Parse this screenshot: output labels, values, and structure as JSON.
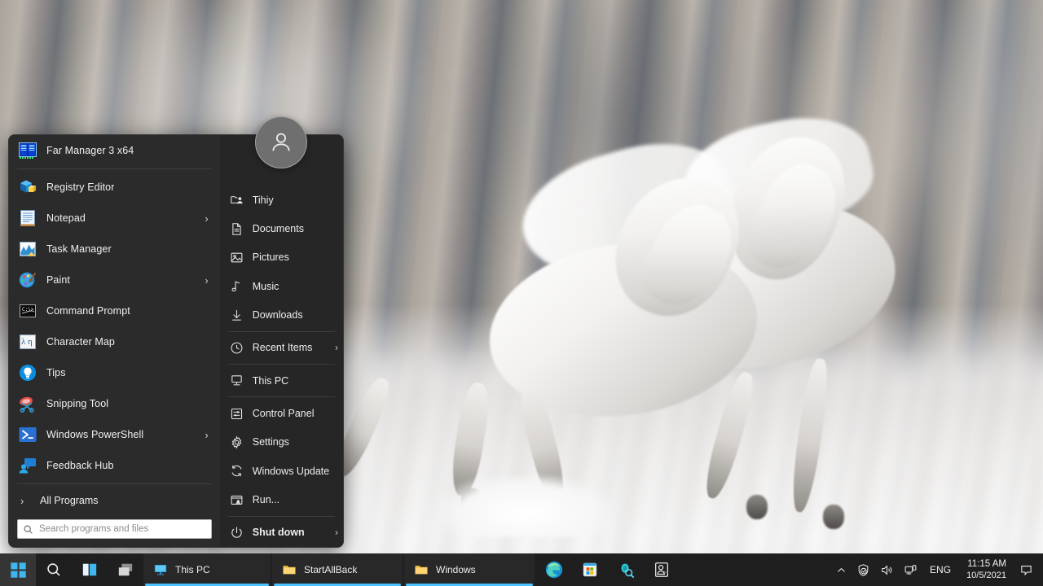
{
  "desktop": {
    "wallpaper_description": "Two white horses galloping in snow (blurred background)"
  },
  "start_menu": {
    "avatar_name": "user-avatar",
    "left_items": [
      {
        "label": "Far Manager 3 x64",
        "icon": "far-manager-icon",
        "submenu": false,
        "pinned": true
      },
      {
        "label": "Registry Editor",
        "icon": "registry-editor-icon",
        "submenu": false
      },
      {
        "label": "Notepad",
        "icon": "notepad-icon",
        "submenu": true
      },
      {
        "label": "Task Manager",
        "icon": "task-manager-icon",
        "submenu": false
      },
      {
        "label": "Paint",
        "icon": "paint-icon",
        "submenu": true
      },
      {
        "label": "Command Prompt",
        "icon": "command-prompt-icon",
        "submenu": false
      },
      {
        "label": "Character Map",
        "icon": "character-map-icon",
        "submenu": false
      },
      {
        "label": "Tips",
        "icon": "tips-icon",
        "submenu": false
      },
      {
        "label": "Snipping Tool",
        "icon": "snipping-tool-icon",
        "submenu": false
      },
      {
        "label": "Windows PowerShell",
        "icon": "powershell-icon",
        "submenu": true
      },
      {
        "label": "Feedback Hub",
        "icon": "feedback-hub-icon",
        "submenu": false
      }
    ],
    "all_programs": {
      "label": "All Programs",
      "chevron": "›"
    },
    "search": {
      "placeholder": "Search programs and files",
      "value": "",
      "icon": "search-icon"
    },
    "right_items": [
      {
        "label": "Tihiy",
        "icon": "user-folder-icon",
        "submenu": false,
        "sep_after": false
      },
      {
        "label": "Documents",
        "icon": "document-icon",
        "submenu": false
      },
      {
        "label": "Pictures",
        "icon": "picture-icon",
        "submenu": false
      },
      {
        "label": "Music",
        "icon": "music-note-icon",
        "submenu": false
      },
      {
        "label": "Downloads",
        "icon": "download-icon",
        "submenu": false,
        "sep_after": true
      },
      {
        "label": "Recent Items",
        "icon": "clock-icon",
        "submenu": true,
        "sep_after": true
      },
      {
        "label": "This PC",
        "icon": "computer-icon",
        "submenu": false,
        "sep_after": true
      },
      {
        "label": "Control Panel",
        "icon": "control-panel-icon",
        "submenu": false
      },
      {
        "label": "Settings",
        "icon": "gear-icon",
        "submenu": false
      },
      {
        "label": "Windows Update",
        "icon": "refresh-icon",
        "submenu": false
      },
      {
        "label": "Run...",
        "icon": "run-icon",
        "submenu": false
      }
    ],
    "shutdown": {
      "label": "Shut down",
      "icon": "power-icon",
      "chevron": "›"
    }
  },
  "taskbar": {
    "start_button": {
      "name": "Start",
      "icon": "windows-logo-icon"
    },
    "search_button": {
      "name": "Search",
      "icon": "search-icon"
    },
    "task_view_button": {
      "name": "Task View",
      "icon": "task-view-icon"
    },
    "widgets_button": {
      "name": "Widgets",
      "icon": "widgets-icon"
    },
    "tasks": [
      {
        "label": "This PC",
        "icon": "this-pc-icon",
        "active": true
      },
      {
        "label": "StartAllBack",
        "icon": "folder-icon",
        "active": true
      },
      {
        "label": "Windows",
        "icon": "folder-icon",
        "active": true
      }
    ],
    "pinned_icons": [
      {
        "name": "Microsoft Edge",
        "icon": "edge-icon"
      },
      {
        "name": "Microsoft Store",
        "icon": "store-icon"
      },
      {
        "name": "Process Explorer",
        "icon": "process-explorer-icon"
      },
      {
        "name": "Autoruns",
        "icon": "autoruns-icon"
      }
    ],
    "tray": {
      "overflow": {
        "name": "Show hidden icons",
        "icon": "chevron-up-icon"
      },
      "security": {
        "name": "Windows Security",
        "icon": "shield-check-icon"
      },
      "volume": {
        "name": "Volume",
        "icon": "speaker-icon"
      },
      "network": {
        "name": "Network",
        "icon": "network-icon"
      },
      "language": "ENG",
      "time": "11:15 AM",
      "date": "10/5/2021",
      "notifications": {
        "name": "Notifications",
        "icon": "chat-bubble-icon"
      }
    }
  },
  "colors": {
    "menu_bg": "#2b2b2b",
    "menu_right_bg": "#262626",
    "taskbar_bg": "#1f1f1f",
    "accent": "#4cc2ff",
    "text": "#f0f0f0"
  }
}
